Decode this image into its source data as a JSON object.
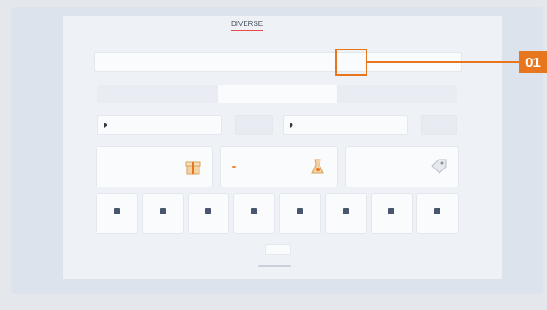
{
  "tabs": [
    {
      "label": "DIVERSE",
      "active": true
    },
    {
      "label": "",
      "active": false
    }
  ],
  "chip_row": {
    "chips": [
      "",
      "",
      "",
      "",
      "",
      "",
      "",
      "",
      "",
      "",
      "",
      ""
    ],
    "selected_index": 7
  },
  "segments": [
    {
      "label": "",
      "active": false
    },
    {
      "label": "",
      "active": true
    },
    {
      "label": "",
      "active": false
    }
  ],
  "fields": [
    {
      "label": ""
    },
    {
      "label": ""
    },
    {
      "label": ""
    },
    {
      "label": ""
    }
  ],
  "cards": [
    {
      "label": "",
      "badge": ""
    },
    {
      "label": "",
      "badge": ""
    },
    {
      "label": "",
      "badge": ""
    }
  ],
  "icon_tiles": [
    {
      "label": ""
    },
    {
      "label": ""
    },
    {
      "label": ""
    },
    {
      "label": ""
    },
    {
      "label": ""
    },
    {
      "label": ""
    },
    {
      "label": ""
    },
    {
      "label": ""
    }
  ],
  "footer": {
    "button_label": ""
  },
  "callout": {
    "number": "01"
  },
  "colors": {
    "accent": "#e8761e",
    "badge": "#ef8a3d",
    "tab_underline": "#e84a4a",
    "icon": "#4a5670",
    "panel_bg": "#eef2f7"
  },
  "icons": [
    "play-triangle-icon",
    "play-triangle-icon",
    "gift-box-icon",
    "lab-flask-icon",
    "tag-label-icon",
    "grid-icon",
    "arrows-icon",
    "pin-icon",
    "split-icon",
    "lock-icon",
    "unlock-icon",
    "check-icon",
    "folder-icon"
  ]
}
